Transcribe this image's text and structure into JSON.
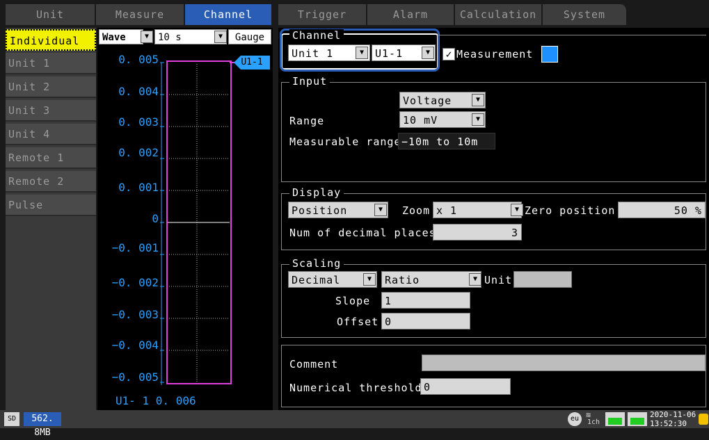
{
  "tabs": [
    {
      "label": "Unit",
      "active": false
    },
    {
      "label": "Measure",
      "active": false
    },
    {
      "label": "Channel",
      "active": true
    },
    {
      "label": "Trigger",
      "active": false
    },
    {
      "label": "Alarm",
      "active": false
    },
    {
      "label": "Calculation",
      "active": false
    },
    {
      "label": "System",
      "active": false
    }
  ],
  "sidebar": {
    "items": [
      {
        "label": "Individual"
      },
      {
        "label": "Unit 1"
      },
      {
        "label": "Unit 2"
      },
      {
        "label": "Unit 3"
      },
      {
        "label": "Unit 4"
      },
      {
        "label": "Remote 1"
      },
      {
        "label": "Remote 2"
      },
      {
        "label": "Pulse"
      }
    ]
  },
  "gauge": {
    "wave_label": "Wave",
    "time_value": "10 s",
    "gauge_label": "Gauge",
    "scale": [
      "0. 005",
      "0. 004",
      "0. 003",
      "0. 002",
      "0. 001",
      "0",
      "−0. 001",
      "−0. 002",
      "−0. 003",
      "−0. 004",
      "−0. 005"
    ],
    "channel_tag": "U1-1",
    "readout": "U1- 1 0. 006",
    "colors": {
      "scale": "#2aa0ff",
      "trace": "#e040e0",
      "tag": "#2aa0ff"
    }
  },
  "channel": {
    "title": "Channel",
    "unit_value": "Unit 1",
    "ch_value": "U1-1",
    "measurement_label": "Measurement",
    "measurement_checked": true,
    "color": "#1e90ff"
  },
  "input": {
    "title": "Input",
    "type_value": "Voltage",
    "range_label": "Range",
    "range_value": "10 mV",
    "measurable_label": "Measurable range",
    "measurable_value": "−10m to 10m"
  },
  "display": {
    "title": "Display",
    "mode_value": "Position",
    "zoom_label": "Zoom",
    "zoom_value": "x 1",
    "zero_label": "Zero position",
    "zero_value": "50 %",
    "decimal_label": "Num of decimal places",
    "decimal_value": "3"
  },
  "scaling": {
    "title": "Scaling",
    "format_value": "Decimal",
    "method_value": "Ratio",
    "unit_label": "Unit",
    "unit_value": "",
    "slope_label": "Slope",
    "slope_value": "1",
    "offset_label": "Offset",
    "offset_value": "0"
  },
  "comment": {
    "comment_label": "Comment",
    "comment_value": "",
    "threshold_label": "Numerical threshold",
    "threshold_value": "0"
  },
  "statusbar": {
    "storage": "562. 8MB",
    "ch_label": "1ch",
    "date": "2020-11-06",
    "time": "13:52:30"
  }
}
